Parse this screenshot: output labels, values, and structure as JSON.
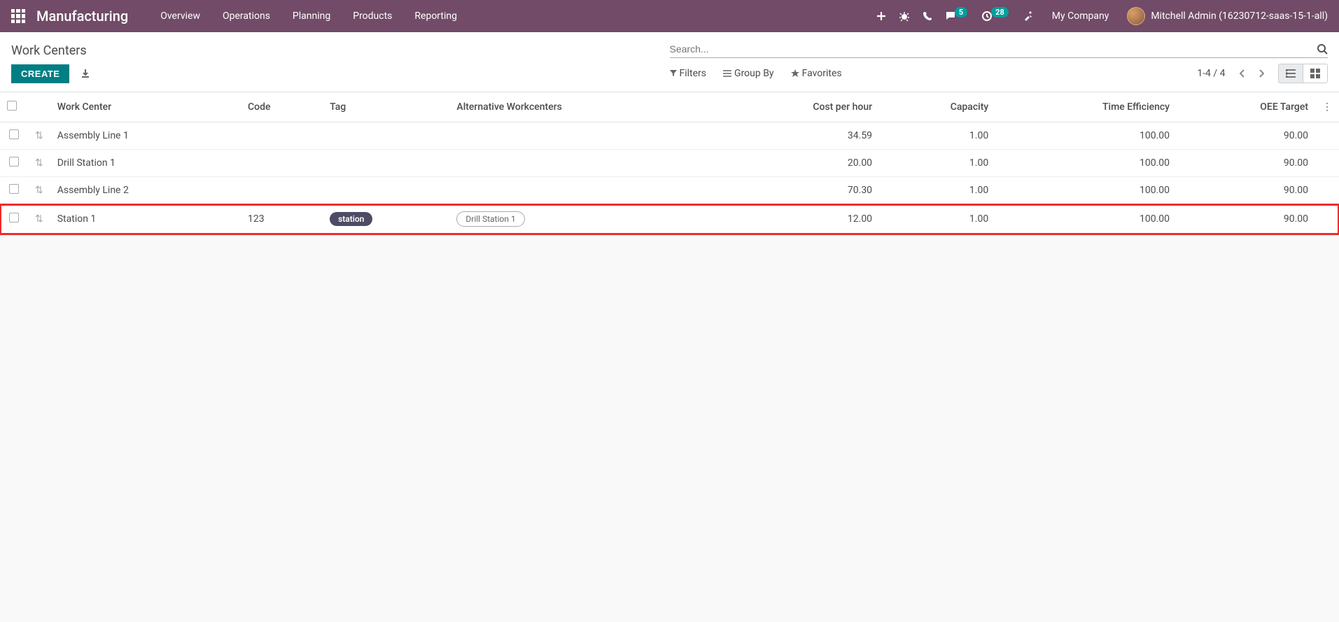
{
  "navbar": {
    "brand": "Manufacturing",
    "menu": [
      "Overview",
      "Operations",
      "Planning",
      "Products",
      "Reporting"
    ],
    "messages_badge": "5",
    "activities_badge": "28",
    "company": "My Company",
    "user": "Mitchell Admin (16230712-saas-15-1-all)"
  },
  "control": {
    "breadcrumb": "Work Centers",
    "search_placeholder": "Search...",
    "create": "CREATE",
    "filters": "Filters",
    "groupby": "Group By",
    "favorites": "Favorites",
    "pager": "1-4 / 4"
  },
  "table": {
    "headers": {
      "name": "Work Center",
      "code": "Code",
      "tag": "Tag",
      "alt": "Alternative Workcenters",
      "cost": "Cost per hour",
      "capacity": "Capacity",
      "eff": "Time Efficiency",
      "oee": "OEE Target"
    },
    "rows": [
      {
        "name": "Assembly Line 1",
        "code": "",
        "tag": "",
        "alt": "",
        "cost": "34.59",
        "capacity": "1.00",
        "eff": "100.00",
        "oee": "90.00",
        "highlight": false
      },
      {
        "name": "Drill Station 1",
        "code": "",
        "tag": "",
        "alt": "",
        "cost": "20.00",
        "capacity": "1.00",
        "eff": "100.00",
        "oee": "90.00",
        "highlight": false
      },
      {
        "name": "Assembly Line 2",
        "code": "",
        "tag": "",
        "alt": "",
        "cost": "70.30",
        "capacity": "1.00",
        "eff": "100.00",
        "oee": "90.00",
        "highlight": false
      },
      {
        "name": "Station 1",
        "code": "123",
        "tag": "station",
        "alt": "Drill Station 1",
        "cost": "12.00",
        "capacity": "1.00",
        "eff": "100.00",
        "oee": "90.00",
        "highlight": true
      }
    ]
  }
}
